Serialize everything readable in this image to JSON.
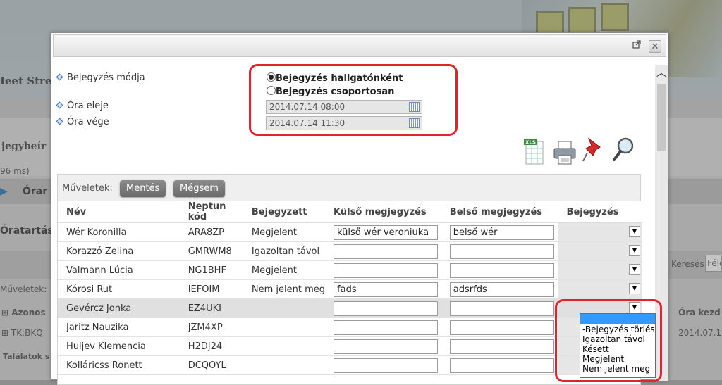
{
  "background": {
    "brand_text": "Ieet Street",
    "section_text": "jegybeír",
    "timing_text": "96 ms)",
    "nav_text": "Órar",
    "panel_title": "Óratartás",
    "ops_label": "Műveletek:",
    "col_azonos": "Azonos",
    "row_code": "TK:BKQ",
    "results": "Találatok s",
    "search_label": "Keresés",
    "search_placeholder": "Féle",
    "col_ora_kezd": "Óra kezd",
    "row_date": "2014.07.1"
  },
  "modal": {
    "fields": {
      "mode_label": "Bejegyzés módja",
      "start_label": "Óra eleje",
      "end_label": "Óra vége",
      "radio_per_student": "Bejegyzés hallgatónként",
      "radio_group": "Bejegyzés csoportosan",
      "start_value": "2014.07.14 08:00",
      "end_value": "2014.07.14 11:30"
    },
    "toolbar": {
      "ops_label": "Műveletek:",
      "save_label": "Mentés",
      "cancel_label": "Mégsem"
    },
    "columns": [
      "Név",
      "Neptun kód",
      "Bejegyzett",
      "Külső megjegyzés",
      "Belső megjegyzés",
      "Bejegyzés"
    ],
    "rows": [
      {
        "name": "Wér Koronilla",
        "code": "ARA8ZP",
        "status": "Megjelent",
        "external": "külső wér veroniuka",
        "internal": "belső wér"
      },
      {
        "name": "Korazzó Zelina",
        "code": "GMRWM8",
        "status": "Igazoltan távol",
        "external": "",
        "internal": ""
      },
      {
        "name": "Valmann Lúcia",
        "code": "NG1BHF",
        "status": "Megjelent",
        "external": "",
        "internal": ""
      },
      {
        "name": "Kórosi Rut",
        "code": "IEFOIM",
        "status": "Nem jelent meg",
        "external": "fads",
        "internal": "adsrfds"
      },
      {
        "name": "Gevércz Jonka",
        "code": "EZ4UKI",
        "status": "",
        "external": "",
        "internal": ""
      },
      {
        "name": "Jaritz Nauzika",
        "code": "JZM4XP",
        "status": "",
        "external": "",
        "internal": ""
      },
      {
        "name": "Huljev Klemencia",
        "code": "H2DJ24",
        "status": "",
        "external": "",
        "internal": ""
      },
      {
        "name": "Kolláricss Ronett",
        "code": "DCQOYL",
        "status": "",
        "external": "",
        "internal": ""
      }
    ],
    "dropdown_options": [
      "-Bejegyzés törlés",
      "Igazoltan távol",
      "Késett",
      "Megjelent",
      "Nem jelent meg"
    ]
  },
  "icons": [
    "external-link-icon",
    "close-icon",
    "xls-icon",
    "print-icon",
    "pin-icon",
    "magnifier-icon",
    "calendar-icon"
  ],
  "colors": {
    "highlight": "#e0242e",
    "selection": "#3399ff",
    "button": "#7a7a7a"
  }
}
